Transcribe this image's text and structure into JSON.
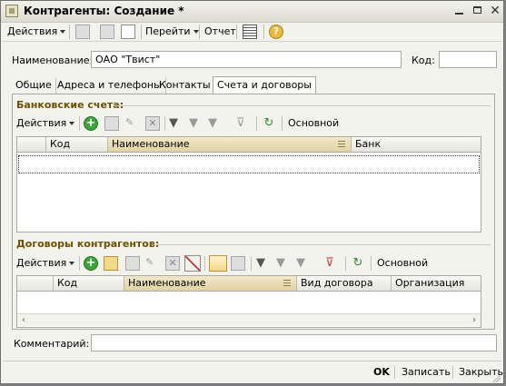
{
  "window": {
    "title": "Контрагенты: Создание *"
  },
  "toolbar": {
    "actions_label": "Действия",
    "goto_label": "Перейти",
    "report_label": "Отчет",
    "help_glyph": "?"
  },
  "form": {
    "name_label": "Наименование:",
    "name_value": "ОАО \"Твист\"",
    "code_label": "Код:",
    "code_value": "",
    "comment_label": "Комментарий:",
    "comment_value": ""
  },
  "tabs": [
    {
      "label": "Общие"
    },
    {
      "label": "Адреса и телефоны"
    },
    {
      "label": "Контакты"
    },
    {
      "label": "Счета и договоры",
      "active": true
    }
  ],
  "bank_accounts": {
    "title": "Банковские счета:",
    "actions_label": "Действия",
    "main_label": "Основной",
    "columns": [
      "",
      "Код",
      "Наименование",
      "Банк"
    ]
  },
  "contracts": {
    "title": "Договоры контрагентов:",
    "actions_label": "Действия",
    "main_label": "Основной",
    "columns": [
      "",
      "Код",
      "Наименование",
      "Вид договора",
      "Организация"
    ]
  },
  "footer": {
    "ok_label": "OK",
    "save_label": "Записать",
    "close_label": "Закрыть"
  },
  "colors": {
    "section_title": "#6b5100",
    "window_bg": "#f3f3ee",
    "sorted_column": "#e0d2a3"
  },
  "icons": [
    "app-icon",
    "minimize-icon",
    "maximize-icon",
    "close-icon",
    "add-icon",
    "copy-icon",
    "edit-icon",
    "delete-icon",
    "filter-icon",
    "refresh-icon",
    "help-icon",
    "structure-icon"
  ]
}
